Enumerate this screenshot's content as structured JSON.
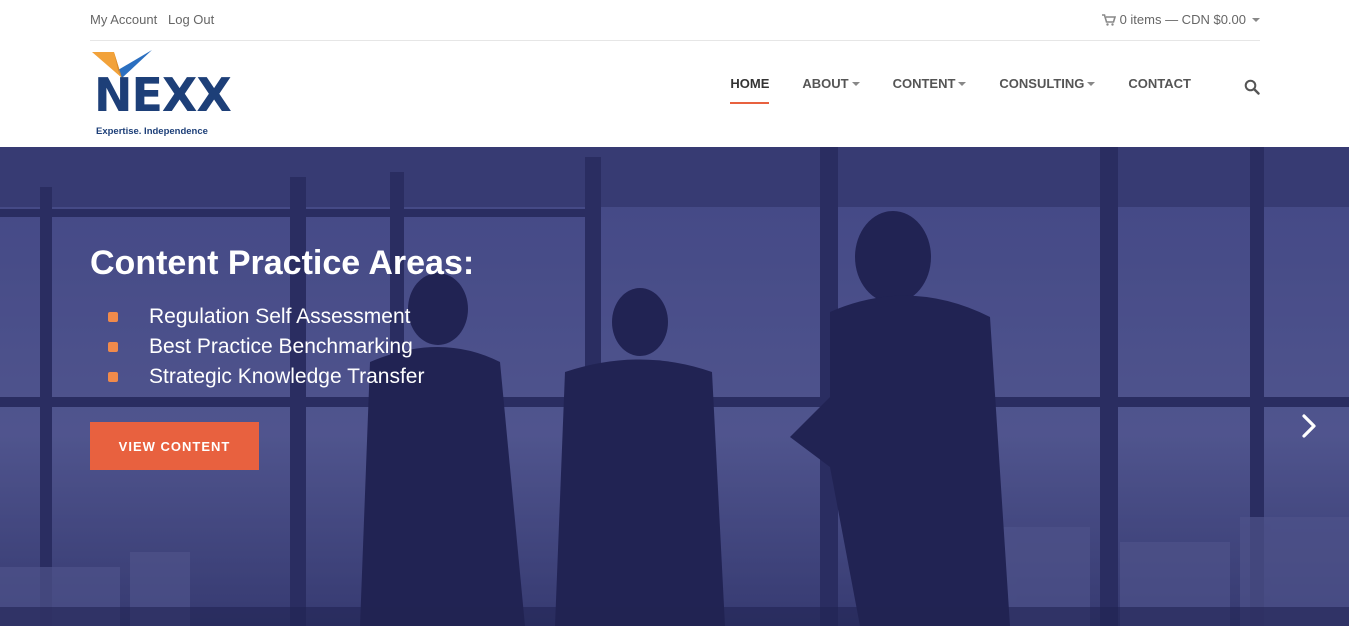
{
  "topbar": {
    "my_account": "My Account",
    "log_out": "Log Out",
    "cart_text": "0 items — CDN $0.00"
  },
  "logo": {
    "word": "NEXX",
    "tagline": "Expertise. Independence"
  },
  "nav": {
    "items": [
      {
        "label": "HOME",
        "dropdown": false,
        "active": true
      },
      {
        "label": "ABOUT",
        "dropdown": true
      },
      {
        "label": "CONTENT",
        "dropdown": true
      },
      {
        "label": "CONSULTING",
        "dropdown": true
      },
      {
        "label": "CONTACT",
        "dropdown": false
      }
    ]
  },
  "hero": {
    "title": "Content Practice Areas:",
    "bullets": [
      "Regulation Self Assessment",
      "Best Practice Benchmarking",
      "Strategic Knowledge Transfer"
    ],
    "cta_label": "VIEW CONTENT"
  },
  "icons": {
    "cart": "cart-icon",
    "search": "search-icon",
    "next": "chevron-right-icon"
  },
  "colors": {
    "accent": "#e8613f",
    "brand_navy": "#1d3f78",
    "hero_overlay": "#2f3366",
    "bullet": "#f08a4b"
  }
}
